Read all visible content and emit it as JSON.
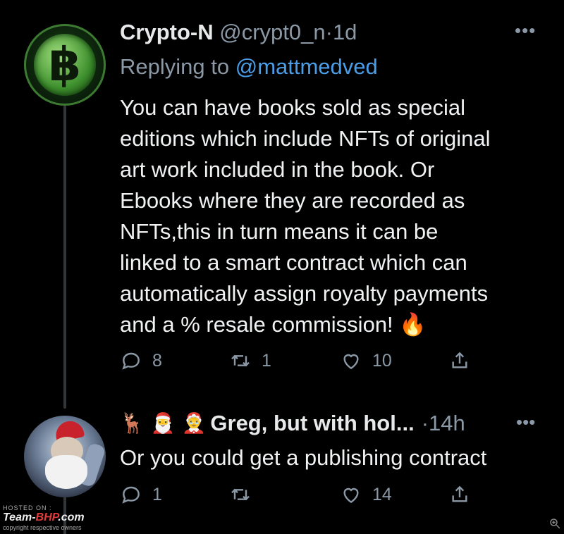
{
  "tweet1": {
    "display_name": "Crypto-N",
    "handle": "@crypt0_n",
    "separator": "·",
    "time": "1d",
    "replying_prefix": "Replying to",
    "replying_mention": "@mattmedved",
    "body_lines": [
      "You can have books sold as special",
      "editions which include NFTs of original",
      "art work included in the book. Or",
      "Ebooks where they are recorded as",
      "NFTs,this in turn means it can be",
      "linked to a smart contract which can",
      "automatically assign royalty payments",
      "and a % resale commission! 🔥"
    ],
    "replies": "8",
    "retweets": "1",
    "likes": "10",
    "more": "•••"
  },
  "tweet2": {
    "emoji": "🦌 🎅 🤶",
    "display_name": "Greg, but with hol...",
    "separator": "·",
    "time": "14h",
    "body": "Or you could get a publishing contract",
    "replies": "1",
    "retweets": "",
    "likes": "14",
    "more": "•••"
  },
  "watermark": {
    "hosted": "HOSTED ON :",
    "brand_prefix": "Team-",
    "brand_accent": "BHP",
    "brand_suffix": ".com",
    "copyright": "copyright respective owners"
  },
  "colors": {
    "background": "#000000",
    "text": "#e7e9ea",
    "muted": "#8b98a5",
    "link": "#4a9ee8"
  },
  "icons": [
    "reply-icon",
    "retweet-icon",
    "like-icon",
    "share-icon",
    "more-icon",
    "zoom-icon"
  ]
}
